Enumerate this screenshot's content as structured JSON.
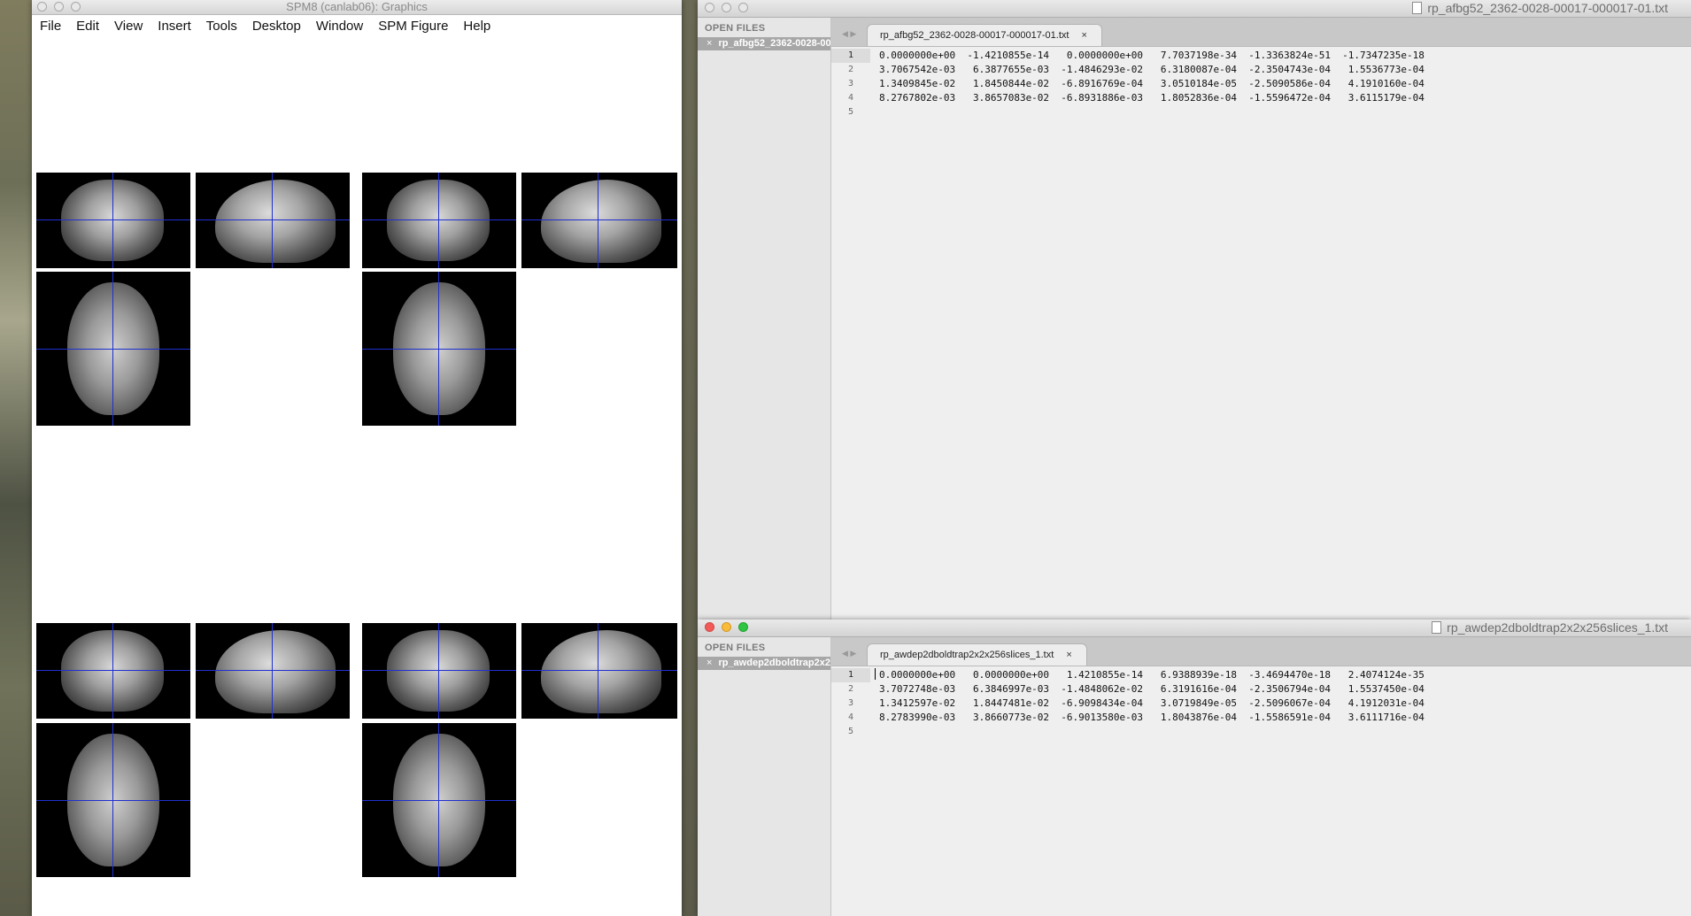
{
  "spm": {
    "title": "SPM8 (canlab06): Graphics",
    "menu": [
      "File",
      "Edit",
      "View",
      "Insert",
      "Tools",
      "Desktop",
      "Window",
      "SPM Figure",
      "Help"
    ]
  },
  "editor_top": {
    "window_title": "rp_afbg52_2362-0028-00017-000017-01.txt",
    "sidebar_header": "OPEN FILES",
    "sidebar_file": "rp_afbg52_2362-0028-00017-000017-01.txt",
    "tab_label": "rp_afbg52_2362-0028-00017-000017-01.txt",
    "tab_close": "×",
    "line_numbers": [
      "1",
      "2",
      "3",
      "4",
      "5"
    ],
    "lines": [
      "0.0000000e+00  -1.4210855e-14   0.0000000e+00   7.7037198e-34  -1.3363824e-51  -1.7347235e-18",
      "3.7067542e-03   6.3877655e-03  -1.4846293e-02   6.3180087e-04  -2.3504743e-04   1.5536773e-04",
      "1.3409845e-02   1.8450844e-02  -6.8916769e-04   3.0510184e-05  -2.5090586e-04   4.1910160e-04",
      "8.2767802e-03   3.8657083e-02  -6.8931886e-03   1.8052836e-04  -1.5596472e-04   3.6115179e-04",
      ""
    ]
  },
  "editor_bottom": {
    "window_title": "rp_awdep2dboldtrap2x2x256slices_1.txt",
    "sidebar_header": "OPEN FILES",
    "sidebar_file": "rp_awdep2dboldtrap2x2x256slices_1.txt",
    "tab_label": "rp_awdep2dboldtrap2x2x256slices_1.txt",
    "tab_close": "×",
    "line_numbers": [
      "1",
      "2",
      "3",
      "4",
      "5"
    ],
    "lines": [
      "0.0000000e+00   0.0000000e+00   1.4210855e-14   6.9388939e-18  -3.4694470e-18   2.4074124e-35",
      "3.7072748e-03   6.3846997e-03  -1.4848062e-02   6.3191616e-04  -2.3506794e-04   1.5537450e-04",
      "1.3412597e-02   1.8447481e-02  -6.9098434e-04   3.0719849e-05  -2.5096067e-04   4.1912031e-04",
      "8.2783990e-03   3.8660773e-02  -6.9013580e-03   1.8043876e-04  -1.5586591e-04   3.6111716e-04",
      ""
    ]
  },
  "icons": {
    "close": "close-icon",
    "minimize": "minimize-icon",
    "zoom": "zoom-icon",
    "document": "document-icon"
  }
}
